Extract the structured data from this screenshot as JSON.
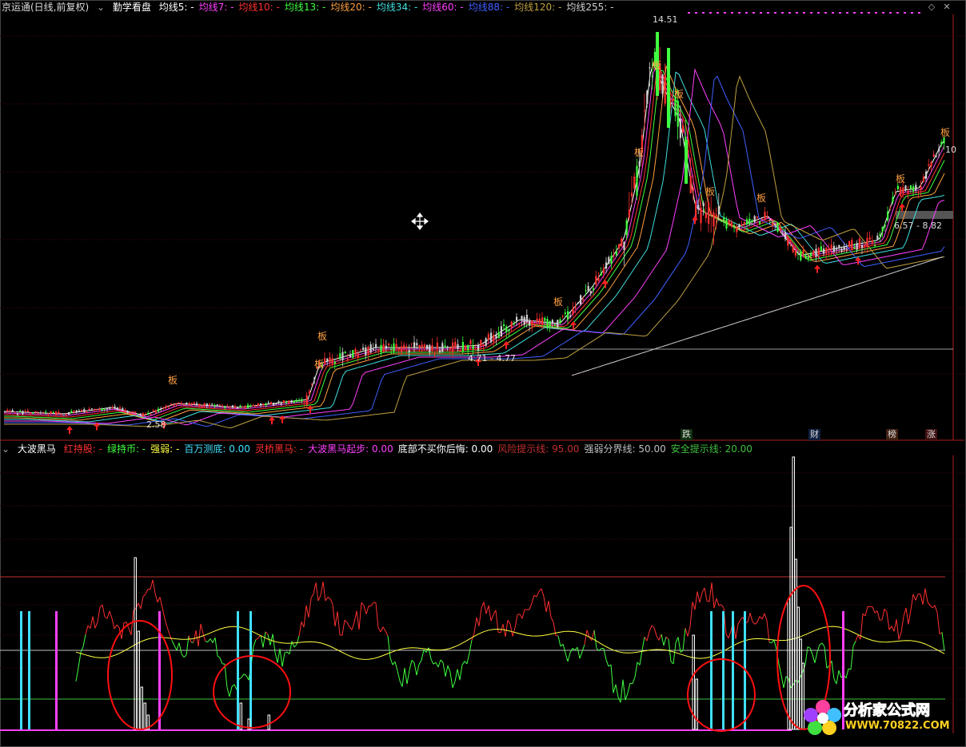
{
  "main_header": {
    "app_title": "京运通(日线,前复权)",
    "indicator_name": "勤学看盘",
    "ma_items": [
      {
        "label": "均线5: -",
        "color": "#ffffff"
      },
      {
        "label": "均线7: -",
        "color": "#ff40ff"
      },
      {
        "label": "均线10: -",
        "color": "#ff3030"
      },
      {
        "label": "均线13: -",
        "color": "#40ff40"
      },
      {
        "label": "均线20: -",
        "color": "#ffa040"
      },
      {
        "label": "均线34: -",
        "color": "#40e0e0"
      },
      {
        "label": "均线60: -",
        "color": "#ff40ff"
      },
      {
        "label": "均线88: -",
        "color": "#4060ff"
      },
      {
        "label": "均线120: -",
        "color": "#c0a040"
      },
      {
        "label": "均线255: -",
        "color": "#d0d0d0"
      }
    ]
  },
  "price_chart": {
    "high_label": "14.51",
    "low_label": "2.58",
    "range_label_1": "4.71 - 4.77",
    "range_label_2": "6.57 - 8.82",
    "right_edge_label": "10",
    "board_mark": "板",
    "bottom_tags": [
      {
        "text": "跌",
        "color": "#40ff40"
      },
      {
        "text": "财",
        "color": "#40a0ff"
      },
      {
        "text": "榜",
        "color": "#ffa040"
      },
      {
        "text": "涨",
        "color": "#ff4040"
      }
    ]
  },
  "sub_header": {
    "indicator_name": "大波黑马",
    "items": [
      {
        "label": "红持股: -",
        "color": "#ff3030"
      },
      {
        "label": "绿持币: -",
        "color": "#40ff40"
      },
      {
        "label": "强弱: -",
        "color": "#ffff40"
      },
      {
        "label": "百万测底: 0.00",
        "color": "#40e0ff"
      },
      {
        "label": "灵桥黑马: -",
        "color": "#ff3030"
      },
      {
        "label": "大波黑马起步: 0.00",
        "color": "#ff40ff"
      },
      {
        "label": "底部不买你后悔: 0.00",
        "color": "#ffffff"
      },
      {
        "label": "风险提示线: 95.00",
        "color": "#c03030"
      },
      {
        "label": "强弱分界线: 50.00",
        "color": "#c0c0c0"
      },
      {
        "label": "安全提示线: 20.00",
        "color": "#40c040"
      }
    ]
  },
  "watermark": {
    "brand": "分析家公式网",
    "url": "WWW.70822.COM"
  },
  "colors": {
    "background": "#000000",
    "grid": "#7a1010",
    "up": "#ff3030",
    "down": "#40ff40"
  }
}
